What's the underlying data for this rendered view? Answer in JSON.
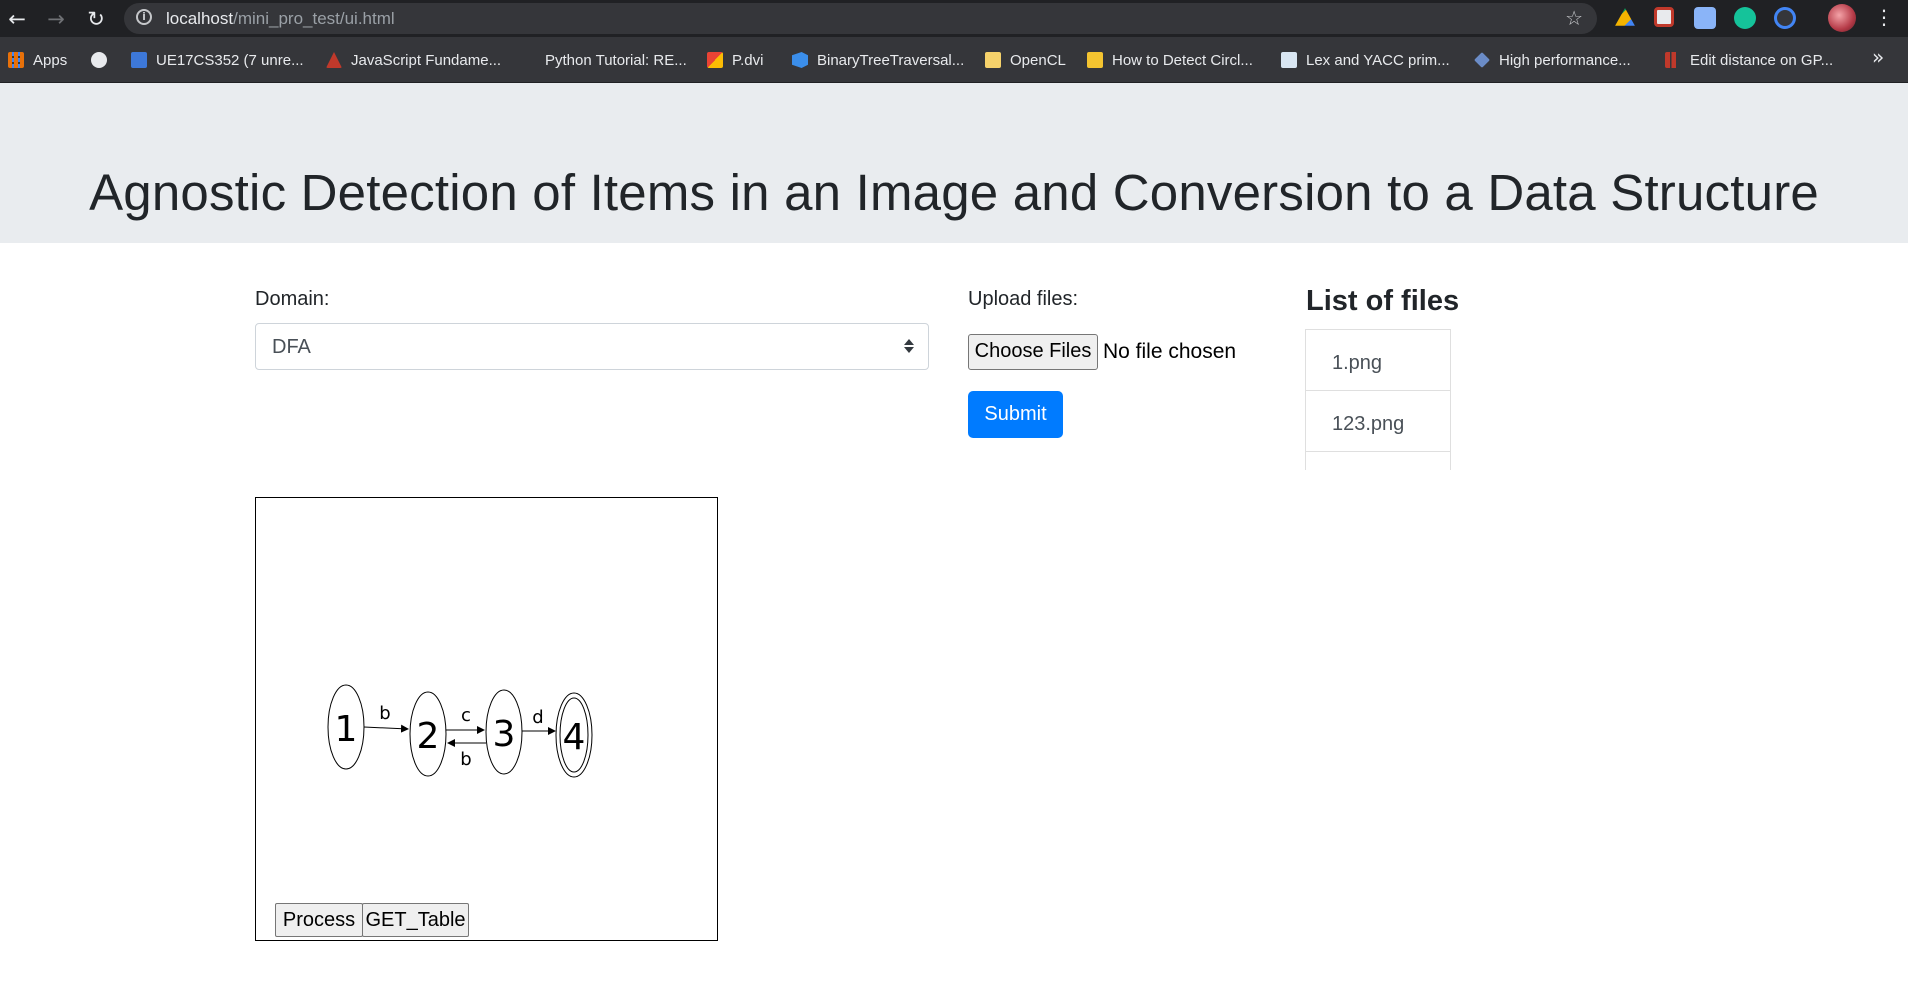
{
  "browser": {
    "url_host": "localhost",
    "url_path": "/mini_pro_test/ui.html",
    "bookmarks": [
      {
        "label": "Apps",
        "icon": "apps-grid-icon",
        "color": "#e8710a"
      },
      {
        "label": "",
        "icon": "globe-icon",
        "color": "#e8eaed"
      },
      {
        "label": "UE17CS352 (7 unre...",
        "icon": "piazza-icon",
        "color": "#3d78d8"
      },
      {
        "label": "JavaScript Fundame...",
        "icon": "javascript-icon",
        "color": "#c0392b"
      },
      {
        "label": "Python Tutorial: RE...",
        "icon": "python-icon",
        "color": "#35363a"
      },
      {
        "label": "P.dvi",
        "icon": "gmail-icon",
        "color": "#ea4335"
      },
      {
        "label": "BinaryTreeTraversal...",
        "icon": "vscode-icon",
        "color": "#3b8eea"
      },
      {
        "label": "OpenCL",
        "icon": "folder-icon",
        "color": "#f6d26b"
      },
      {
        "label": "How to Detect Circl...",
        "icon": "pencil-icon",
        "color": "#f4c430"
      },
      {
        "label": "Lex and YACC prim...",
        "icon": "page-icon",
        "color": "#d9e6f2"
      },
      {
        "label": "High performance...",
        "icon": "diamond-icon",
        "color": "#6b8cc7"
      },
      {
        "label": "Edit distance on GP...",
        "icon": "chart-icon",
        "color": "#c0392b"
      }
    ]
  },
  "page": {
    "title": "Agnostic Detection of Items in an Image and Conversion to a Data Structure",
    "domain_label": "Domain:",
    "domain_value": "DFA",
    "upload_label": "Upload files:",
    "choose_files_label": "Choose Files",
    "file_status": "No file chosen",
    "submit_label": "Submit",
    "list_title": "List of files",
    "files": [
      "1.png",
      "123.png"
    ],
    "process_label": "Process",
    "get_table_label": "GET_Table",
    "accent_color": "#007bff"
  },
  "dfa_image": {
    "states": [
      "1",
      "2",
      "3",
      "4"
    ],
    "transitions": [
      "b",
      "c",
      "b",
      "d"
    ]
  }
}
